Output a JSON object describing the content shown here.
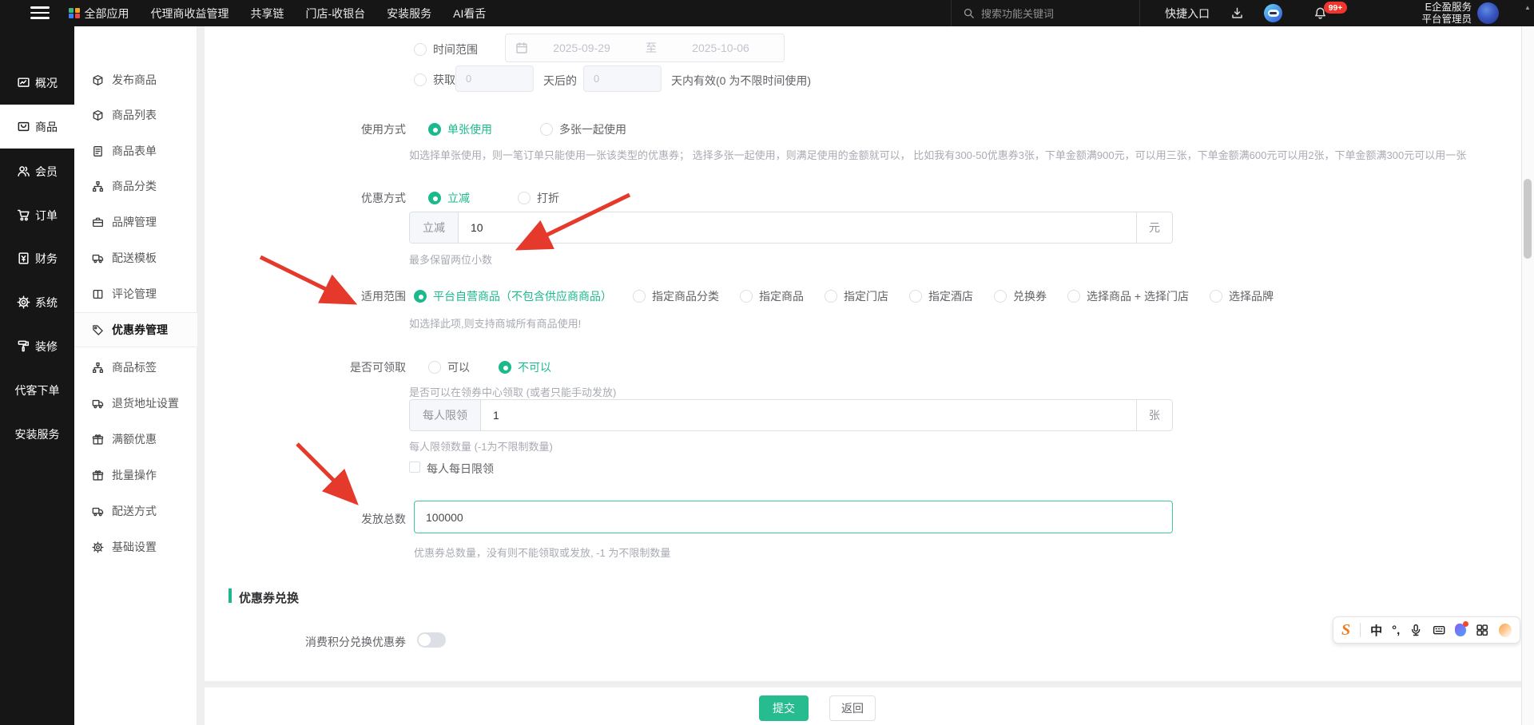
{
  "colors": {
    "accent": "#1cb98d",
    "annotation_red": "#e5392b",
    "badge_red": "#f0352c",
    "topbar_bg": "#161616"
  },
  "topbar": {
    "nav": [
      {
        "label": "全部应用",
        "icon": "apps-grid-icon"
      },
      {
        "label": "代理商收益管理"
      },
      {
        "label": "共享链"
      },
      {
        "label": "门店-收银台"
      },
      {
        "label": "安装服务"
      },
      {
        "label": "AI看舌"
      }
    ],
    "search": {
      "placeholder": "搜索功能关键词",
      "icon": "search-icon"
    },
    "quick_entry": "快捷入口",
    "notification_badge": "99+",
    "account": {
      "line1": "E企盈服务",
      "line2": "平台管理员"
    }
  },
  "sidebar": {
    "items": [
      {
        "label": "概况",
        "icon": "dashboard-icon"
      },
      {
        "label": "商品",
        "icon": "goods-icon",
        "active": true
      },
      {
        "label": "会员",
        "icon": "users-icon"
      },
      {
        "label": "订单",
        "icon": "cart-icon"
      },
      {
        "label": "财务",
        "icon": "finance-icon"
      },
      {
        "label": "系统",
        "icon": "gear-icon"
      },
      {
        "label": "装修",
        "icon": "paint-roller-icon"
      },
      {
        "label": "代客下单"
      },
      {
        "label": "安装服务"
      }
    ]
  },
  "submenu": {
    "items": [
      {
        "label": "发布商品",
        "icon": "cube-icon"
      },
      {
        "label": "商品列表",
        "icon": "cube-icon"
      },
      {
        "label": "商品表单",
        "icon": "document-icon"
      },
      {
        "label": "商品分类",
        "icon": "tree-icon"
      },
      {
        "label": "品牌管理",
        "icon": "briefcase-icon"
      },
      {
        "label": "配送模板",
        "icon": "truck-icon"
      },
      {
        "label": "评论管理",
        "icon": "book-icon"
      },
      {
        "label": "优惠券管理",
        "icon": "tag-icon",
        "active": true
      },
      {
        "label": "商品标签",
        "icon": "tree-icon"
      },
      {
        "label": "退货地址设置",
        "icon": "truck-icon"
      },
      {
        "label": "满额优惠",
        "icon": "gift-icon"
      },
      {
        "label": "批量操作",
        "icon": "gift-icon"
      },
      {
        "label": "配送方式",
        "icon": "truck-icon"
      },
      {
        "label": "基础设置",
        "icon": "gear-icon"
      }
    ]
  },
  "form": {
    "time_range": {
      "label": "时间范围",
      "start": "2025-09-29",
      "separator": "至",
      "end": "2025-10-06"
    },
    "acquire": {
      "label": "获取",
      "days_value": "0",
      "middle": "天后的",
      "valid_value": "0",
      "suffix": "天内有效(0 为不限时间使用)"
    },
    "usage": {
      "label": "使用方式",
      "option1": "单张使用",
      "option2": "多张一起使用",
      "selected": "单张使用",
      "help": "如选择单张使用，则一笔订单只能使用一张该类型的优惠券； 选择多张一起使用，则满足使用的金额就可以， 比如我有300-50优惠券3张，下单金额满900元，可以用三张，下单金额满600元可以用2张，下单金额满300元可以用一张"
    },
    "discount": {
      "label": "优惠方式",
      "option1": "立减",
      "option2": "打折",
      "selected": "立减",
      "input_prefix": "立减",
      "input_value": "10",
      "input_suffix": "元",
      "help": "最多保留两位小数"
    },
    "scope": {
      "label": "适用范围",
      "options": [
        "平台自营商品（不包含供应商商品）",
        "指定商品分类",
        "指定商品",
        "指定门店",
        "指定酒店",
        "兑换券",
        "选择商品 + 选择门店",
        "选择品牌"
      ],
      "selected": "平台自营商品（不包含供应商商品）",
      "help": "如选择此项,则支持商城所有商品使用!"
    },
    "claim": {
      "label": "是否可领取",
      "option1": "可以",
      "option2": "不可以",
      "selected": "不可以",
      "help": "是否可以在领券中心领取 (或者只能手动发放)",
      "limit_prefix": "每人限领",
      "limit_value": "1",
      "limit_suffix": "张",
      "limit_help": "每人限领数量 (-1为不限制数量)",
      "daily_label": "每人每日限领",
      "daily_checked": false
    },
    "total": {
      "label": "发放总数",
      "value": "100000",
      "help": "优惠券总数量，没有则不能领取或发放, -1 为不限制数量"
    },
    "exchange": {
      "title": "优惠券兑换",
      "toggle_label": "消费积分兑换优惠券",
      "toggle_on": false
    },
    "actions": {
      "submit": "提交",
      "back": "返回"
    }
  },
  "ime_bar": {
    "logo": "S",
    "mode": "中",
    "punct": "°,",
    "icons": [
      "microphone-icon",
      "keyboard-icon",
      "skin-blob-icon",
      "toolbox-grid-icon",
      "emoji-face-icon"
    ]
  }
}
